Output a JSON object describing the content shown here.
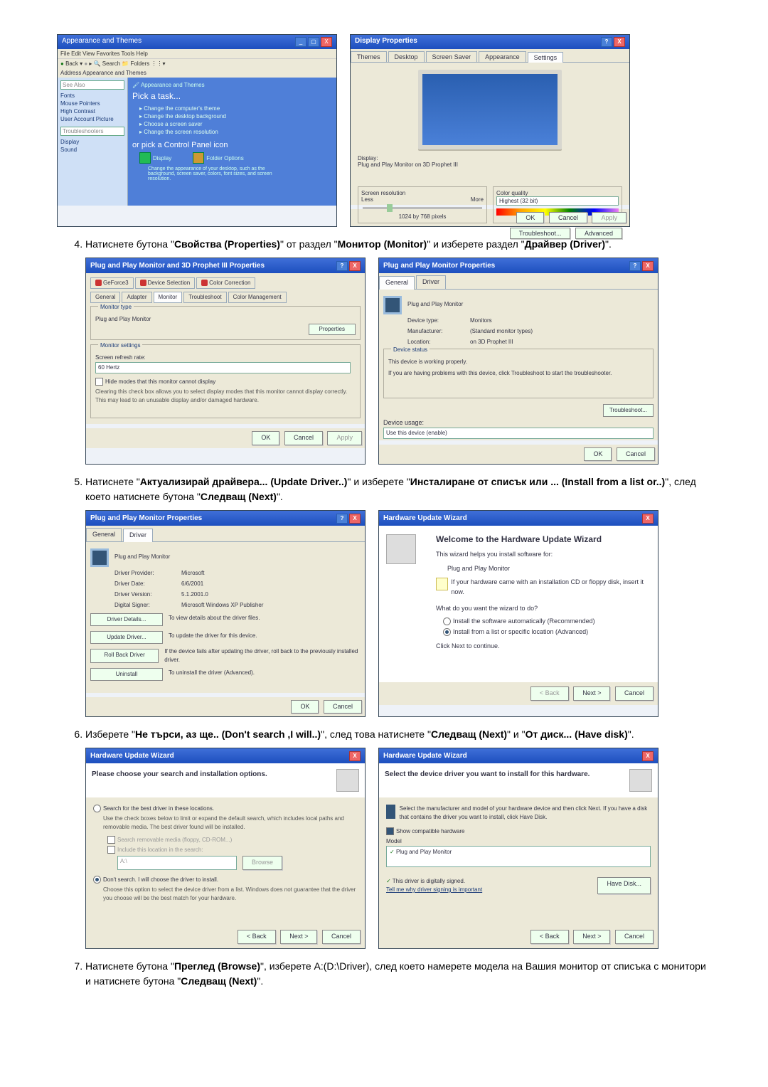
{
  "step4": {
    "number": "4.",
    "pre1": "Натиснете бутона \"",
    "b1": "Свойства (Properties)",
    "mid1": "\" от раздел \"",
    "b2": "Монитор (Monitor)",
    "mid2": "\" и изберете раздел \"",
    "b3": "Драйвер (Driver)",
    "post": "\"."
  },
  "step5": {
    "number": "5.",
    "pre1": "Натиснете \"",
    "b1": "Актуализирай драйвера... (Update Driver..)",
    "mid1": "\" и изберете \"",
    "b2": "Инсталиране от списък или ... (Install from a list or..)",
    "mid2": "\", след което натиснете бутона \"",
    "b3": "Следващ (Next)",
    "post": "\"."
  },
  "step6": {
    "number": "6.",
    "pre1": "Изберете \"",
    "b1": "Не търси, аз ще.. (Don't search ,I will..)",
    "mid1": "\", след това натиснете \"",
    "b2": "Следващ (Next)",
    "mid2": "\" и \"",
    "b3": "От диск... (Have disk)",
    "post": "\"."
  },
  "step7": {
    "number": "7.",
    "pre1": "Натиснете бутона \"",
    "b1": "Преглед (Browse)",
    "mid1": "\", изберете A:(D:\\Driver), след което намерете модела на Вашия монитор от списъка с монитори и натиснете бутона \"",
    "b2": "Следващ (Next)",
    "post": "\"."
  },
  "cp": {
    "title": "Appearance and Themes",
    "toolbar": "File  Edit  View  Favorites  Tools  Help",
    "addr": "Address  Appearance and Themes",
    "seealso": "See Also",
    "links": [
      "Fonts",
      "Mouse Pointers",
      "High Contrast",
      "User Account Picture"
    ],
    "troubleshoot": "Troubleshooters",
    "tlinks": [
      "Display",
      "Sound"
    ],
    "pick": "Pick a task...",
    "tasks": [
      "Change the computer's theme",
      "Change the desktop background",
      "Choose a screen saver",
      "Change the screen resolution"
    ],
    "orpick": "or pick a Control Panel icon",
    "icon1": "Display",
    "icon2": "Folder Options",
    "note": "Change the appearance of your desktop, such as the background, screen saver, colors, font sizes, and screen resolution."
  },
  "dp": {
    "title": "Display Properties",
    "tabs": [
      "Themes",
      "Desktop",
      "Screen Saver",
      "Appearance",
      "Settings"
    ],
    "display_label": "Display:",
    "display_value": "Plug and Play Monitor on 3D Prophet III",
    "res_group": "Screen resolution",
    "res_less": "Less",
    "res_more": "More",
    "res_val": "1024 by 768 pixels",
    "col_group": "Color quality",
    "col_val": "Highest (32 bit)",
    "troubleshoot": "Troubleshoot...",
    "advanced": "Advanced",
    "ok": "OK",
    "cancel": "Cancel",
    "apply": "Apply"
  },
  "p3": {
    "title": "Plug and Play Monitor and 3D Prophet III Properties",
    "tabs_top": [
      "GeForce3",
      "Device Selection",
      "Color Correction"
    ],
    "tabs_bot": [
      "General",
      "Adapter",
      "Monitor",
      "Troubleshoot",
      "Color Management"
    ],
    "mt_group": "Monitor type",
    "mt_value": "Plug and Play Monitor",
    "prop_btn": "Properties",
    "ms_group": "Monitor settings",
    "refresh_label": "Screen refresh rate:",
    "refresh_val": "60 Hertz",
    "hide_chk": "Hide modes that this monitor cannot display",
    "hide_desc": "Clearing this check box allows you to select display modes that this monitor cannot display correctly. This may lead to an unusable display and/or damaged hardware.",
    "ok": "OK",
    "cancel": "Cancel",
    "apply": "Apply"
  },
  "pnp": {
    "title": "Plug and Play Monitor Properties",
    "tabs": [
      "General",
      "Driver"
    ],
    "name": "Plug and Play Monitor",
    "devtype_l": "Device type:",
    "devtype_v": "Monitors",
    "manu_l": "Manufacturer:",
    "manu_v": "(Standard monitor types)",
    "loc_l": "Location:",
    "loc_v": "on 3D Prophet III",
    "status_group": "Device status",
    "status_text": "This device is working properly.",
    "status_help": "If you are having problems with this device, click Troubleshoot to start the troubleshooter.",
    "troubleshoot": "Troubleshoot...",
    "usage_l": "Device usage:",
    "usage_v": "Use this device (enable)",
    "ok": "OK",
    "cancel": "Cancel"
  },
  "drv": {
    "title": "Plug and Play Monitor Properties",
    "tabs": [
      "General",
      "Driver"
    ],
    "name": "Plug and Play Monitor",
    "prov_l": "Driver Provider:",
    "prov_v": "Microsoft",
    "date_l": "Driver Date:",
    "date_v": "6/6/2001",
    "ver_l": "Driver Version:",
    "ver_v": "5.1.2001.0",
    "sign_l": "Digital Signer:",
    "sign_v": "Microsoft Windows XP Publisher",
    "b_det": "Driver Details...",
    "b_det_d": "To view details about the driver files.",
    "b_upd": "Update Driver...",
    "b_upd_d": "To update the driver for this device.",
    "b_roll": "Roll Back Driver",
    "b_roll_d": "If the device fails after updating the driver, roll back to the previously installed driver.",
    "b_un": "Uninstall",
    "b_un_d": "To uninstall the driver (Advanced).",
    "ok": "OK",
    "cancel": "Cancel"
  },
  "wiz1": {
    "title": "Hardware Update Wizard",
    "h": "Welcome to the Hardware Update Wizard",
    "intro": "This wizard helps you install software for:",
    "dev": "Plug and Play Monitor",
    "cd": "If your hardware came with an installation CD or floppy disk, insert it now.",
    "q": "What do you want the wizard to do?",
    "o1": "Install the software automatically (Recommended)",
    "o2": "Install from a list or specific location (Advanced)",
    "cont": "Click Next to continue.",
    "back": "< Back",
    "next": "Next >",
    "cancel": "Cancel"
  },
  "wiz2": {
    "title": "Hardware Update Wizard",
    "h": "Please choose your search and installation options.",
    "o1": "Search for the best driver in these locations.",
    "o1d": "Use the check boxes below to limit or expand the default search, which includes local paths and removable media. The best driver found will be installed.",
    "c1": "Search removable media (floppy, CD-ROM...)",
    "c2": "Include this location in the search:",
    "path": "A:\\",
    "browse": "Browse",
    "o2": "Don't search. I will choose the driver to install.",
    "o2d": "Choose this option to select the device driver from a list. Windows does not guarantee that the driver you choose will be the best match for your hardware.",
    "back": "< Back",
    "next": "Next >",
    "cancel": "Cancel"
  },
  "wiz3": {
    "title": "Hardware Update Wizard",
    "h": "Select the device driver you want to install for this hardware.",
    "desc": "Select the manufacturer and model of your hardware device and then click Next. If you have a disk that contains the driver you want to install, click Have Disk.",
    "compat": "Show compatible hardware",
    "model": "Model",
    "entry": "Plug and Play Monitor",
    "signed": "This driver is digitally signed.",
    "tell": "Tell me why driver signing is important",
    "havedisk": "Have Disk...",
    "back": "< Back",
    "next": "Next >",
    "cancel": "Cancel"
  }
}
